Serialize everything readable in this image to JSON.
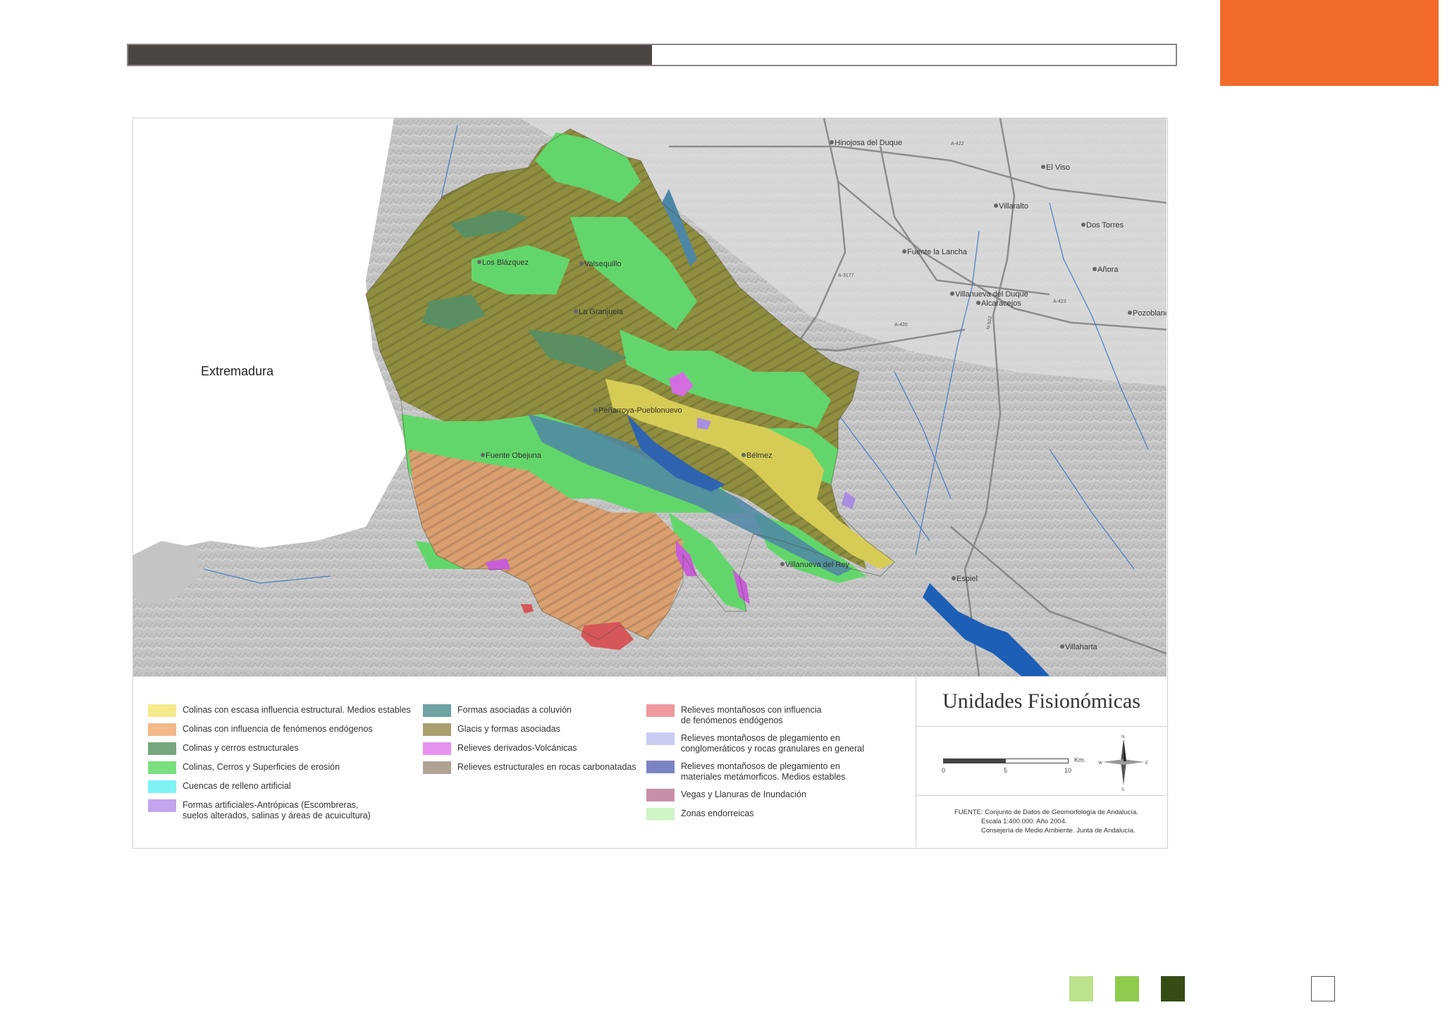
{
  "header": {
    "progress_fraction": 0.5
  },
  "map": {
    "region_label": "Extremadura",
    "towns": [
      "Hinojosa del Duque",
      "El Viso",
      "Villaralto",
      "Dos Torres",
      "Fuente la Lancha",
      "Añora",
      "Villanueva del Duque",
      "Alcaracejos",
      "Pozoblanco",
      "Los Blázquez",
      "Valsequillo",
      "La Granjuela",
      "Peñarroya-Pueblonuevo",
      "Fuente Obejuna",
      "Bélmez",
      "Villanueva del Rey",
      "Espiel",
      "Villaharta"
    ],
    "road_labels": [
      "A-420",
      "N-502",
      "A-423",
      "A-422",
      "A-3177"
    ]
  },
  "legend": {
    "items": [
      {
        "label": "Colinas con escasa influencia estructural. Medios estables",
        "color": "#f5ea8c"
      },
      {
        "label": "Colinas con influencia de fenómenos endógenos",
        "color": "#f2b98a"
      },
      {
        "label": "Colinas y cerros estructurales",
        "color": "#76a77e"
      },
      {
        "label": "Colinas, Cerros y Superficies de erosión",
        "color": "#79e07f"
      },
      {
        "label": "Cuencas de relleno artificial",
        "color": "#7ef2f5"
      },
      {
        "label": "Formas artificiales-Antrópicas (Escombreras,",
        "label2": "suelos alterados, salinas y áreas de acuicultura)",
        "color": "#c3a5ee"
      },
      {
        "label": "Formas asociadas a coluvión",
        "color": "#6ea2a3"
      },
      {
        "label": "Glacis y formas asociadas",
        "color": "#a8a06d"
      },
      {
        "label": "Relieves derivados-Volcánicas",
        "color": "#e792ef"
      },
      {
        "label": "Relieves estructurales en rocas carbonatadas",
        "color": "#b0a394"
      },
      {
        "label": "Relieves montañosos con influencia",
        "label2": "de fenómenos endógenos",
        "color": "#ee9aa0"
      },
      {
        "label": "Relieves montañosos de plegamiento en",
        "label2": "conglomeráticos y rocas granulares en general",
        "color": "#c9cdf4"
      },
      {
        "label": "Relieves montañosos de plegamiento en",
        "label2": "materiales metámorficos. Medios estables",
        "color": "#7c84c2"
      },
      {
        "label": "Vegas y Llanuras de Inundación",
        "color": "#c78ea8"
      },
      {
        "label": "Zonas endorreicas",
        "color": "#cff5c6"
      }
    ]
  },
  "title_panel": {
    "title": "Unidades Fisionómicas",
    "scale": {
      "t0": "0",
      "t1": "5",
      "t2": "10",
      "unit": "Km."
    },
    "compass": {
      "n": "N",
      "s": "S",
      "e": "E",
      "w": "W"
    },
    "source_lines": [
      "FUENTE: Conjunto de Datos de Geomorfología de Andalucía.",
      "Escala 1:400.000. Año 2004.",
      "Consejería de Medio Ambiente. Junta de Andalucía."
    ]
  },
  "footer": {
    "colors": [
      "#bde28e",
      "#8fcb4d",
      "#344d14"
    ]
  }
}
